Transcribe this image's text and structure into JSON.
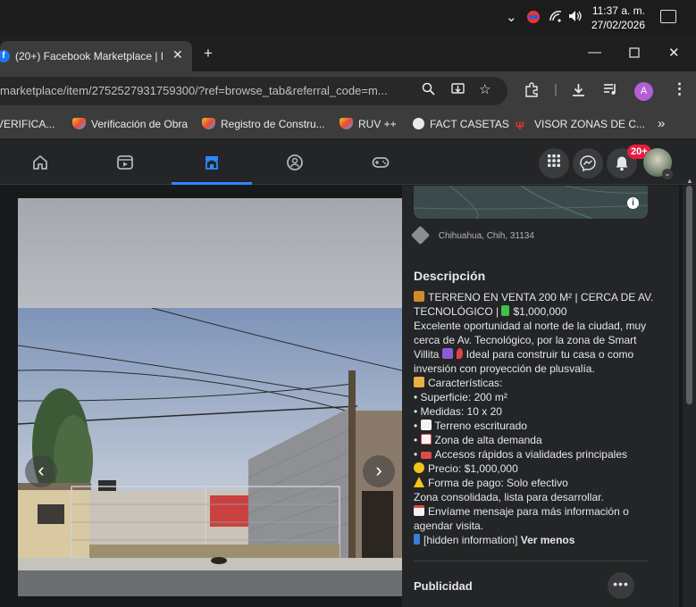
{
  "system_tray": {
    "time": "11:37 a. m.",
    "date": "27/02/2026"
  },
  "browser": {
    "tab_title": "(20+) Facebook Marketplace | F",
    "url": "marketplace/item/2752527931759300/?ref=browse_tab&referral_code=m...",
    "profile_initial": "A",
    "bookmarks": [
      {
        "label": "VERIFICA...",
        "icon": "ruv-icon"
      },
      {
        "label": "Verificación de Obra",
        "icon": "ruv-icon"
      },
      {
        "label": "Registro de Constru...",
        "icon": "ruv-icon"
      },
      {
        "label": "RUV ++",
        "icon": "ruv-icon"
      },
      {
        "label": "FACT CASETAS",
        "icon": "globe-icon"
      },
      {
        "label": "VISOR ZONAS DE C...",
        "icon": "red-logo-icon"
      }
    ]
  },
  "facebook": {
    "notification_count": "20+",
    "active_tab": "marketplace"
  },
  "listing": {
    "location": "Chihuahua, Chih, 31134",
    "description_title": "Descripción",
    "description_lines": [
      "TERRENO EN VENTA 200 M² | CERCA DE AV.",
      "TECNOLÓGICO | ",
      "Excelente oportunidad al norte de la ciudad, muy",
      "cerca de Av. Tecnológico, por la zona de Smart",
      "Villita ",
      "inversión con proyección de plusvalía.",
      "Características:",
      "• Superficie: 200 m²",
      "• Medidas: 10 x 20",
      "• ",
      "• ",
      "• ",
      "Precio: $1,000,000",
      "Forma de pago: Solo efectivo",
      "Zona consolidada, lista para desarrollar.",
      "Envíame mensaje para más información o",
      "agendar visita.",
      "[hidden information] "
    ],
    "desc_price_inline": "$1,000,000",
    "desc_ideal": "Ideal para construir tu casa o como",
    "desc_bullet_escriturado": "Terreno escriturado",
    "desc_bullet_demanda": "Zona de alta demanda",
    "desc_bullet_accesos": "Accesos rápidos a vialidades principales",
    "see_less": "Ver menos",
    "advertising_title": "Publicidad"
  }
}
